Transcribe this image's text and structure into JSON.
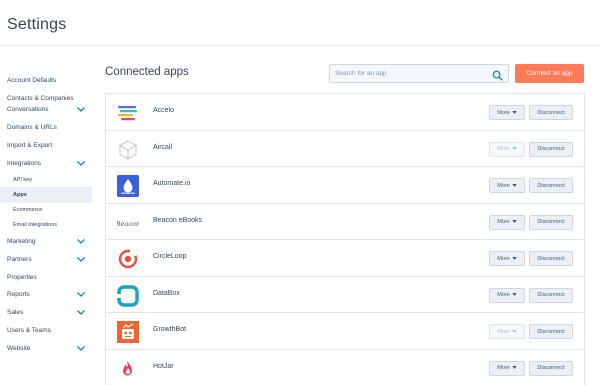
{
  "page": {
    "title": "Settings"
  },
  "sidebar": {
    "items": [
      {
        "label": "Account Defaults",
        "chevron": false,
        "active": false,
        "sub": false
      },
      {
        "label": "Contacts & Companies",
        "chevron": false,
        "active": false,
        "sub": false
      },
      {
        "label": "Conversations",
        "chevron": true,
        "active": false,
        "sub": false
      },
      {
        "label": "Domains & URLs",
        "chevron": false,
        "active": false,
        "sub": false
      },
      {
        "label": "Import & Export",
        "chevron": false,
        "active": false,
        "sub": false
      },
      {
        "label": "Integrations",
        "chevron": true,
        "active": false,
        "sub": false
      },
      {
        "label": "API key",
        "chevron": false,
        "active": false,
        "sub": true
      },
      {
        "label": "Apps",
        "chevron": false,
        "active": true,
        "sub": true
      },
      {
        "label": "Ecommerce",
        "chevron": false,
        "active": false,
        "sub": true
      },
      {
        "label": "Email Integrations",
        "chevron": false,
        "active": false,
        "sub": true
      },
      {
        "label": "Marketing",
        "chevron": true,
        "active": false,
        "sub": false
      },
      {
        "label": "Partners",
        "chevron": true,
        "active": false,
        "sub": false
      },
      {
        "label": "Properties",
        "chevron": false,
        "active": false,
        "sub": false
      },
      {
        "label": "Reports",
        "chevron": true,
        "active": false,
        "sub": false
      },
      {
        "label": "Sales",
        "chevron": true,
        "active": false,
        "sub": false
      },
      {
        "label": "Users & Teams",
        "chevron": false,
        "active": false,
        "sub": false
      },
      {
        "label": "Website",
        "chevron": true,
        "active": false,
        "sub": false
      }
    ]
  },
  "main": {
    "title": "Connected apps",
    "search": {
      "placeholder": "Search for an app",
      "value": ""
    },
    "connect_label": "Connect an app",
    "more_label": "More",
    "disconnect_label": "Disconnect",
    "apps": [
      {
        "name": "Accelo",
        "logo": "accelo-logo",
        "more_enabled": true
      },
      {
        "name": "Aircall",
        "logo": "aircall-logo",
        "more_enabled": false
      },
      {
        "name": "Automate.io",
        "logo": "automate-io-logo",
        "more_enabled": true
      },
      {
        "name": "Beacon eBooks",
        "logo": "beacon-logo",
        "logo_text": "Beacon",
        "more_enabled": true
      },
      {
        "name": "CircleLoop",
        "logo": "circleloop-logo",
        "more_enabled": true
      },
      {
        "name": "DataBox",
        "logo": "databox-logo",
        "more_enabled": true
      },
      {
        "name": "GrowthBot",
        "logo": "growthbot-logo",
        "more_enabled": false
      },
      {
        "name": "HotJar",
        "logo": "hotjar-logo",
        "more_enabled": true
      }
    ]
  },
  "colors": {
    "accent": "#ff7a59",
    "text": "#33475b",
    "border": "#dfe3eb",
    "button_bg": "#eaf0f6",
    "active_nav_bg": "#eaf0f6",
    "chevron": "#0091ae"
  }
}
